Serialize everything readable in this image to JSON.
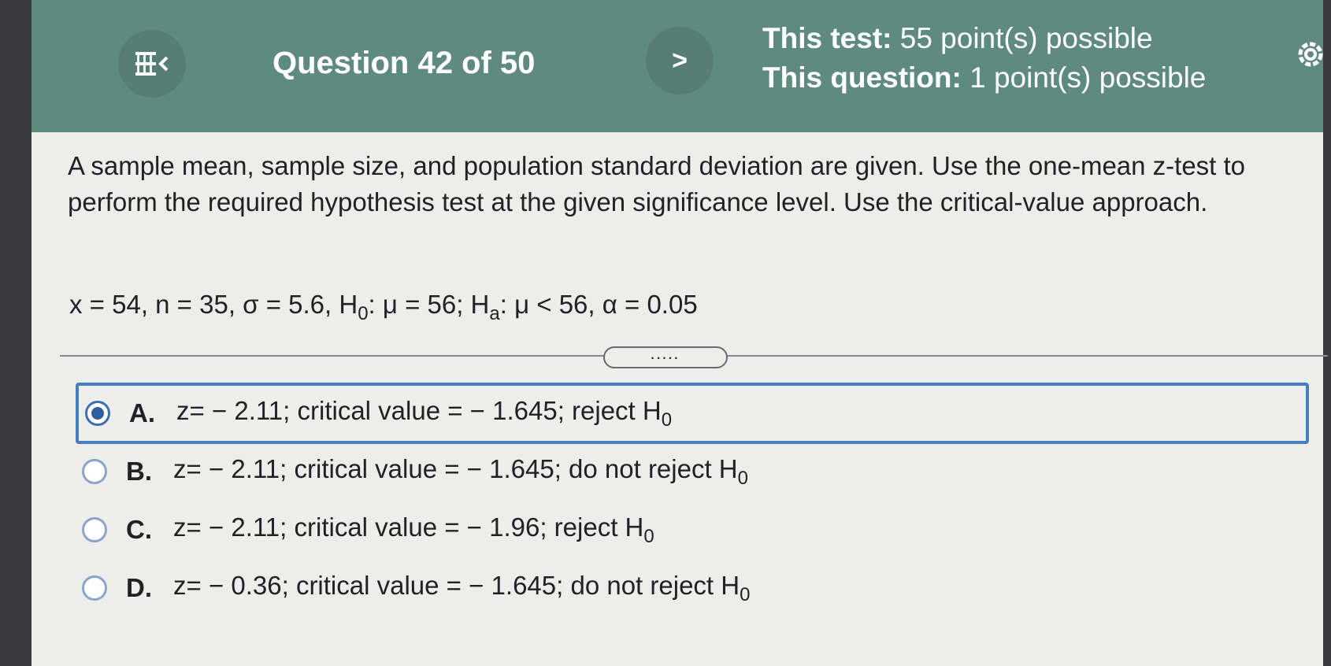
{
  "header": {
    "question_label": "Question 42 of 50",
    "next_symbol": ">",
    "test_points_label": "This test:",
    "test_points_value": "55 point(s) possible",
    "question_points_label": "This question:",
    "question_points_value": "1 point(s) possible"
  },
  "question": {
    "prompt": "A sample mean, sample size, and population standard deviation are given. Use the one-mean z-test to perform the required hypothesis test at the given significance level. Use the critical-value approach.",
    "given_part1": "x = 54, n = 35, σ = 5.6, H",
    "given_sub1": "0",
    "given_part2": ": μ = 56; H",
    "given_sub2": "a",
    "given_part3": ": μ < 56, α = 0.05",
    "divider_dots": "....."
  },
  "options": [
    {
      "letter": "A.",
      "text": "z= − 2.11; critical value = − 1.645; reject H",
      "sub": "0",
      "selected": true
    },
    {
      "letter": "B.",
      "text": "z= − 2.11; critical value = − 1.645; do not reject H",
      "sub": "0",
      "selected": false
    },
    {
      "letter": "C.",
      "text": "z= − 2.11; critical value = − 1.96; reject H",
      "sub": "0",
      "selected": false
    },
    {
      "letter": "D.",
      "text": "z= − 0.36; critical value = − 1.645; do not reject H",
      "sub": "0",
      "selected": false
    }
  ],
  "colors": {
    "header_bg": "#5f8a80",
    "selected_border": "#4a7dbd",
    "radio_selected": "#2f5f9f"
  },
  "icons": {
    "menu": "menu-collapse-icon",
    "next": "chevron-right-icon",
    "settings": "gear-icon"
  }
}
